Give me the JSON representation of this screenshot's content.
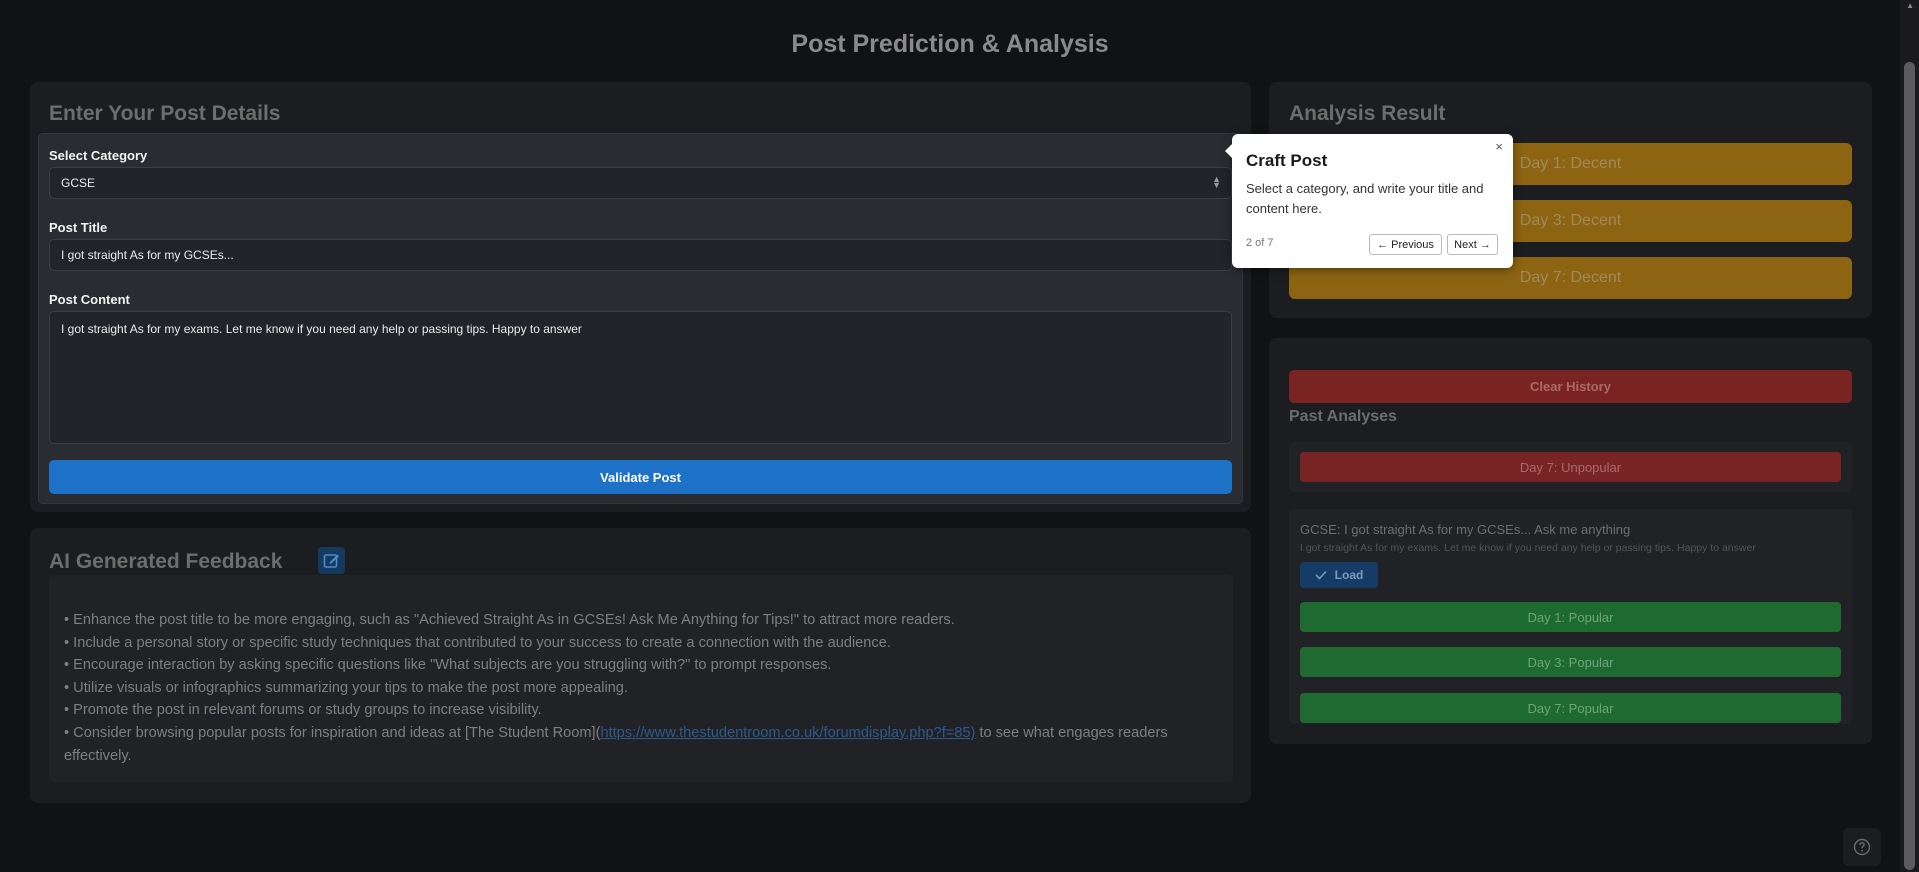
{
  "page": {
    "title": "Post Prediction & Analysis"
  },
  "form": {
    "heading": "Enter Your Post Details",
    "category_label": "Select Category",
    "category_value": "GCSE",
    "title_label": "Post Title",
    "title_value": "I got straight As for my GCSEs...",
    "content_label": "Post Content",
    "content_value": "I got straight As for my exams. Let me know if you need any help or passing tips. Happy to answer",
    "validate_label": "Validate Post"
  },
  "analysis": {
    "heading": "Analysis Result",
    "results": [
      "Day 1: Decent",
      "Day 3: Decent",
      "Day 7: Decent"
    ],
    "result_color": "#8c6412"
  },
  "history": {
    "clear_label": "Clear History",
    "heading": "Past Analyses",
    "first_entry": {
      "results": [
        "Day 7: Unpopular"
      ]
    },
    "second_entry": {
      "title": "GCSE: I got straight As for my GCSEs... Ask me anything",
      "content": "I got straight As for my exams. Let me know if you need any help or passing tips. Happy to answer",
      "load_label": "Load",
      "results": [
        "Day 1: Popular",
        "Day 3: Popular",
        "Day 7: Popular"
      ]
    },
    "colors": {
      "unpopular": "#792424",
      "popular": "#1f6a30"
    }
  },
  "feedback": {
    "heading": "AI Generated Feedback",
    "items": [
      "• Enhance the post title to be more engaging, such as \"Achieved Straight As in GCSEs! Ask Me Anything for Tips!\" to attract more readers.",
      "• Include a personal story or specific study techniques that contributed to your success to create a connection with the audience.",
      "• Encourage interaction by asking specific questions like \"What subjects are you struggling with?\" to prompt responses.",
      "• Utilize visuals or infographics summarizing your tips to make the post more appealing.",
      "• Promote the post in relevant forums or study groups to increase visibility."
    ],
    "last_item_prefix": "• Consider browsing popular posts for inspiration and ideas at [The Student Room](",
    "last_item_link": "https://www.thestudentroom.co.uk/forumdisplay.php?f=85)",
    "last_item_suffix": " to see what engages readers effectively."
  },
  "tour": {
    "title": "Craft Post",
    "description": "Select a category, and write your title and content here.",
    "progress": "2 of 7",
    "prev_label": "← Previous",
    "next_label": "Next →",
    "close_label": "×"
  },
  "icons": {
    "edit": "edit-icon",
    "check": "check-icon",
    "help": "help-icon",
    "close": "close-icon"
  },
  "accent_color": "#1d72c7"
}
